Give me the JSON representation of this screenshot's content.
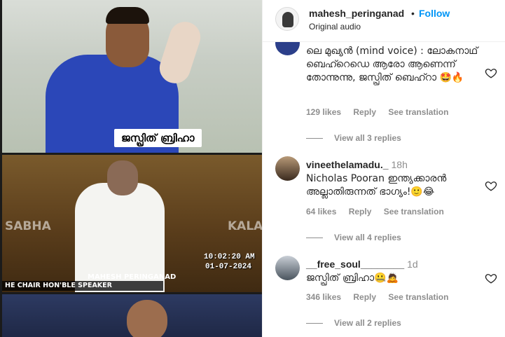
{
  "media": {
    "caption_1": "ജസ്പ്രിത് ബ്രിഹാ",
    "watermark_left": "SABHA",
    "watermark_right": "KALA",
    "timestamp_time": "10:02:20 AM",
    "timestamp_date": "01-07-2024",
    "lower_third_name": "MAHESH PERINGANAD",
    "lower_third_strip": "HE CHAIR HON'BLE SPEAKER"
  },
  "header": {
    "username": "mahesh_peringanad",
    "separator": "•",
    "follow_label": "Follow",
    "audio_label": "Original audio"
  },
  "comments": [
    {
      "username": "",
      "age": "",
      "text": "ലെ മുഖ്യൻ (mind voice) : ലോകനാഥ് ബെഹ്റെഡെ ആരോ ആണെന്ന് തോന്നുന്നു, ജസ്പ്രിത് ബെഹ്റാ 🤩🔥",
      "likes": "129 likes",
      "reply_label": "Reply",
      "translate_label": "See translation",
      "view_replies": "View all 3 replies",
      "avatar_color": "#2b3f8a"
    },
    {
      "username": "vineethelamadu._",
      "age": "18h",
      "text": "Nicholas Pooran ഇന്ത്യക്കാരൻ അല്ലാതിരുന്നത് ഭാഗ്യം!🙂😂",
      "likes": "64 likes",
      "reply_label": "Reply",
      "translate_label": "See translation",
      "view_replies": "View all 4 replies",
      "avatar_color": "#4a3a2a"
    },
    {
      "username": "__free_soul________",
      "age": "1d",
      "text": "ജസ്പ്രിത് ബ്രിഹാ🤐🙇",
      "likes": "346 likes",
      "reply_label": "Reply",
      "translate_label": "See translation",
      "view_replies": "View all 2 replies",
      "avatar_color": "#5a6470"
    }
  ],
  "colors": {
    "accent": "#0095f6",
    "text": "#262626",
    "muted": "#8e8e8e"
  }
}
